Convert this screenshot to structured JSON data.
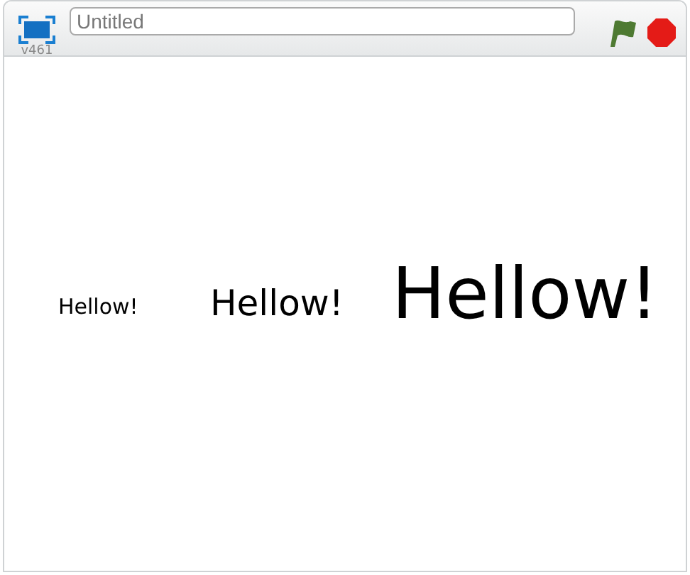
{
  "header": {
    "version": "v461",
    "title_field": {
      "placeholder": "Untitled"
    }
  },
  "stage": {
    "sprites": [
      {
        "text": "Hellow!",
        "kind": "small"
      },
      {
        "text": "Hellow!",
        "kind": "medium"
      },
      {
        "text": "Hellow!",
        "kind": "large"
      }
    ]
  }
}
